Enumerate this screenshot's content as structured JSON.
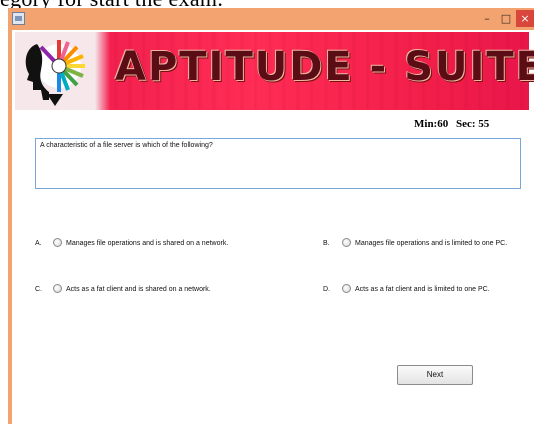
{
  "page_caption": "egory for start the exam.",
  "window": {
    "controls": {
      "minimize": "–",
      "maximize": "□",
      "close": "×"
    }
  },
  "banner": {
    "title": "APTITUDE - SUITE"
  },
  "timer": {
    "min": "Min:60",
    "sec": "Sec: 55"
  },
  "question": {
    "text": "A characteristic of a file server is which of the following?"
  },
  "options": [
    {
      "letter": "A.",
      "text": "Manages file operations and is shared on a network.",
      "selected": false
    },
    {
      "letter": "B.",
      "text": "Manages file operations and is limited to one PC.",
      "selected": false
    },
    {
      "letter": "C.",
      "text": "Acts as a fat client and is shared on a network.",
      "selected": false
    },
    {
      "letter": "D.",
      "text": "Acts as a fat client and is limited to one PC.",
      "selected": false
    }
  ],
  "next_button": {
    "label": "Next"
  },
  "colors": {
    "window_frame": "#f2a36f",
    "banner_red": "#ff2d55",
    "banner_title": "#5a0d14",
    "question_border": "#7aa7d9",
    "close_button": "#d9463c"
  }
}
